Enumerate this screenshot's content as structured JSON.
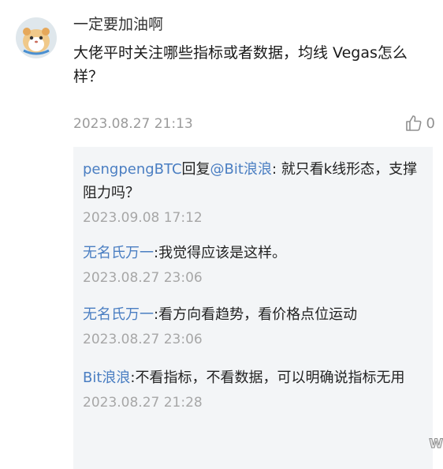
{
  "post": {
    "username": "一定要加油啊",
    "content": "大佬平时关注哪些指标或者数据，均线 Vegas怎么样？",
    "timestamp": "2023.08.27 21:13",
    "like_count": "0"
  },
  "replies": [
    {
      "author": "pengpengBTC",
      "reply_word": "回复",
      "target": "@Bit浪浪",
      "text": ": 就只看k线形态，支撑阻力吗？",
      "timestamp": "2023.09.08 17:12"
    },
    {
      "author": "无名氏万一",
      "text": ":我觉得应该是这样。",
      "timestamp": "2023.08.27 23:06"
    },
    {
      "author": "无名氏万一",
      "text": ":看方向看趋势，看价格点位运动",
      "timestamp": "2023.08.27 23:06"
    },
    {
      "author": "Bit浪浪",
      "text": ":不看指标，不看数据，可以明确说指标无用",
      "timestamp": "2023.08.27 21:28"
    }
  ],
  "watermark": "W",
  "icons": {
    "avatar": "hamster-avatar",
    "like": "thumbs-up-icon"
  }
}
